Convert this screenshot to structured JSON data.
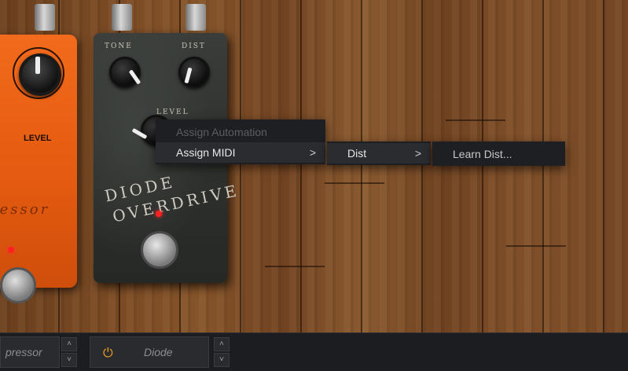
{
  "pedals": {
    "left": {
      "knob_label": "LEVEL",
      "name_partial": "ressor"
    },
    "diode": {
      "tone_label": "TONE",
      "dist_label": "DIST",
      "level_label": "LEVEL",
      "title_line1": "DIODE",
      "title_line2": "OVERDRIVE"
    }
  },
  "context_menu": {
    "items": [
      {
        "label": "Assign Automation",
        "enabled": false
      },
      {
        "label": "Assign MIDI",
        "has_submenu": true
      }
    ],
    "submenu": {
      "items": [
        {
          "label": "Dist",
          "has_submenu": true
        }
      ]
    },
    "subsubmenu": {
      "items": [
        {
          "label": "Learn Dist..."
        }
      ]
    },
    "chevron": ">"
  },
  "bottom_bar": {
    "slot1_text": "pressor",
    "slot2_text": "Diode",
    "up_glyph": "˄",
    "down_glyph": "˅",
    "power_glyph": "⏻",
    "power_color": "#f0a020"
  },
  "colors": {
    "menu_bg": "#1e1f22",
    "led": "#ff2020",
    "orange_pedal": "#e35a10"
  }
}
